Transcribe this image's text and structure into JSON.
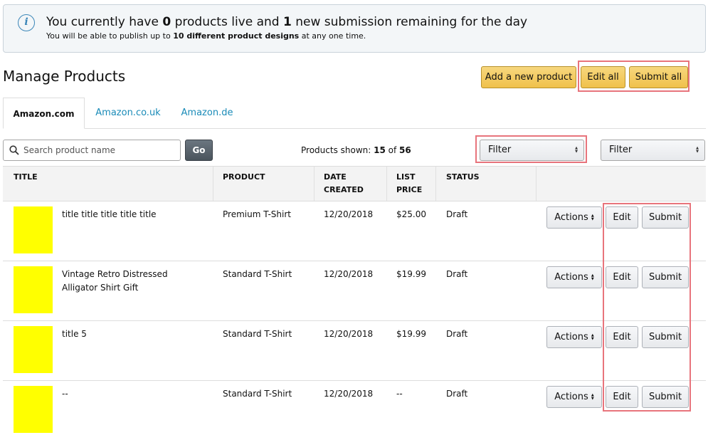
{
  "banner": {
    "icon": "info-icon",
    "line1_prefix": "You currently have ",
    "live_count": "0",
    "line1_middle": " products live and ",
    "remaining_count": "1",
    "line1_suffix": " new submission remaining for the day",
    "line2_prefix": "You will be able to publish up to ",
    "line2_bold": "10 different product designs",
    "line2_suffix": " at any one time."
  },
  "page_title": "Manage Products",
  "actions": {
    "add_new": "Add a new product",
    "edit_all": "Edit all",
    "submit_all": "Submit all"
  },
  "tabs": [
    {
      "label": "Amazon.com",
      "active": true
    },
    {
      "label": "Amazon.co.uk",
      "active": false
    },
    {
      "label": "Amazon.de",
      "active": false
    }
  ],
  "search": {
    "placeholder": "Search product name",
    "go_label": "Go"
  },
  "products_shown": {
    "label": "Products shown: ",
    "shown": "15",
    "of": " of ",
    "total": "56"
  },
  "filters": [
    {
      "value": "Filter"
    },
    {
      "value": "Filter"
    }
  ],
  "table": {
    "headers": {
      "title": "TITLE",
      "product": "PRODUCT",
      "date_line1": "DATE",
      "date_line2": "CREATED",
      "price_line1": "LIST",
      "price_line2": "PRICE",
      "status": "STATUS"
    },
    "rows": [
      {
        "title_line1": "title title title title title",
        "title_line2": "",
        "product": "Premium T-Shirt",
        "date": "12/20/2018",
        "price": "$25.00",
        "status": "Draft"
      },
      {
        "title_line1": "Vintage Retro Distressed",
        "title_line2": "Alligator Shirt Gift",
        "product": "Standard T-Shirt",
        "date": "12/20/2018",
        "price": "$19.99",
        "status": "Draft"
      },
      {
        "title_line1": "title 5",
        "title_line2": "",
        "product": "Standard T-Shirt",
        "date": "12/20/2018",
        "price": "$19.99",
        "status": "Draft"
      },
      {
        "title_line1": "--",
        "title_line2": "",
        "product": "Standard T-Shirt",
        "date": "12/20/2018",
        "price": "--",
        "status": "Draft"
      }
    ],
    "row_actions": {
      "actions_label": "Actions",
      "edit_label": "Edit",
      "submit_label": "Submit"
    }
  },
  "colors": {
    "thumbnail": "#ffff00",
    "highlight": "#e8747c",
    "link": "#1a8bb8",
    "primary_button": "#f0c14b"
  }
}
